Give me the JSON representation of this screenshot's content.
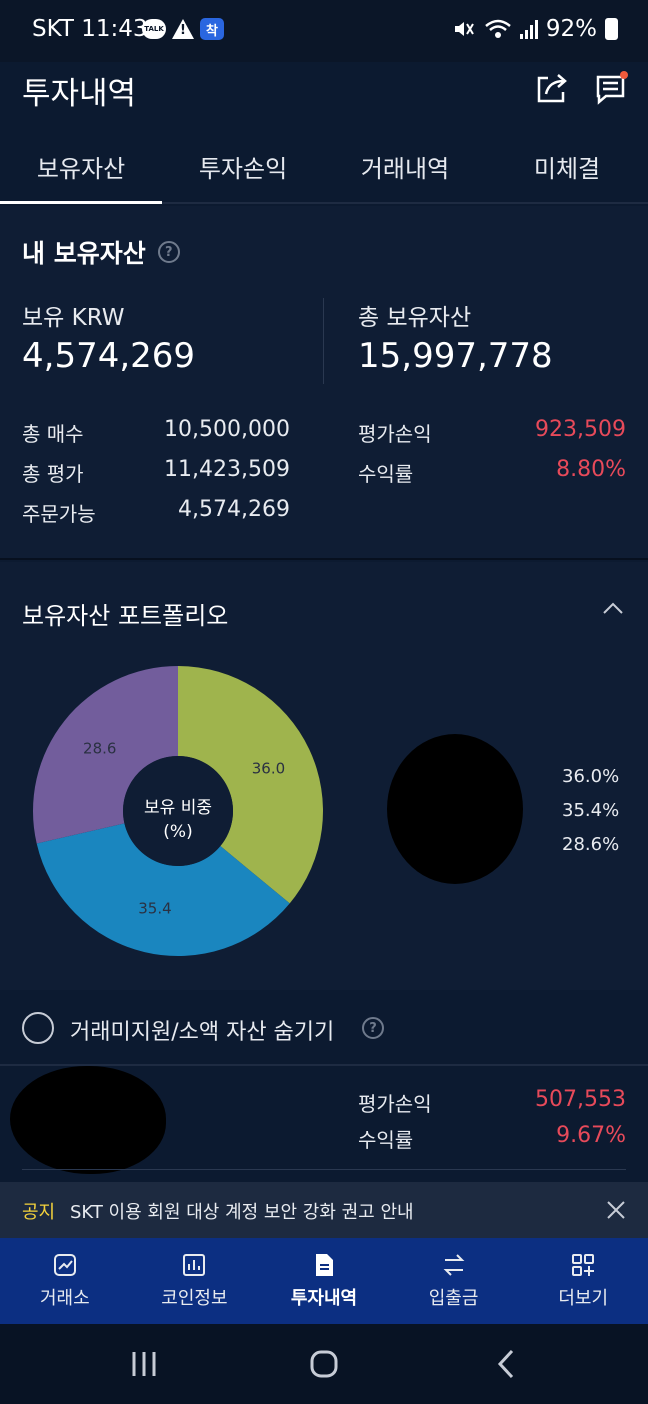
{
  "status_bar": {
    "carrier_time": "SKT 11:43",
    "talk_badge": "TALK",
    "app_badge": "착",
    "battery": "92%"
  },
  "header": {
    "title": "투자내역",
    "icons": [
      "share-icon",
      "message-icon"
    ]
  },
  "tabs": [
    {
      "label": "보유자산",
      "active": true
    },
    {
      "label": "투자손익",
      "active": false
    },
    {
      "label": "거래내역",
      "active": false
    },
    {
      "label": "미체결",
      "active": false
    }
  ],
  "holdings": {
    "title": "내 보유자산",
    "krw_label": "보유 KRW",
    "krw_value": "4,574,269",
    "total_label": "총 보유자산",
    "total_value": "15,997,778",
    "rows_left": [
      {
        "label": "총 매수",
        "value": "10,500,000"
      },
      {
        "label": "총 평가",
        "value": "11,423,509"
      },
      {
        "label": "주문가능",
        "value": "4,574,269"
      }
    ],
    "rows_right": [
      {
        "label": "평가손익",
        "value": "923,509"
      },
      {
        "label": "수익률",
        "value": "8.80%"
      }
    ]
  },
  "portfolio": {
    "title": "보유자산 포트폴리오",
    "center_label_1": "보유 비중",
    "center_label_2": "(%)",
    "legend": [
      "36.0%",
      "35.4%",
      "28.6%"
    ]
  },
  "chart_data": {
    "type": "pie",
    "title": "",
    "categories": [
      "",
      "",
      ""
    ],
    "values": [
      36.0,
      35.4,
      28.6
    ],
    "value_labels": [
      "36.0",
      "35.4",
      "28.6"
    ],
    "colors": [
      "#9fb44d",
      "#1a86bf",
      "#725d9c"
    ],
    "donut": true
  },
  "hide_small": {
    "label": "거래미지원/소액 자산 숨기기"
  },
  "asset_item": {
    "pl_label": "평가손익",
    "pl_value": "507,553",
    "rate_label": "수익률",
    "rate_value": "9.67%"
  },
  "notice": {
    "tag": "공지",
    "text": "SKT 이용 회원 대상 계정 보안 강화 권고 안내"
  },
  "bottom_nav": [
    {
      "label": "거래소",
      "icon": "chart-line-icon",
      "active": false
    },
    {
      "label": "코인정보",
      "icon": "bar-chart-icon",
      "active": false
    },
    {
      "label": "투자내역",
      "icon": "document-icon",
      "active": true
    },
    {
      "label": "입출금",
      "icon": "transfer-icon",
      "active": false
    },
    {
      "label": "더보기",
      "icon": "grid-plus-icon",
      "active": false
    }
  ],
  "colors": {
    "background": "#0c1a30",
    "panel": "#0f1d34",
    "negative_red": "#e74a5a",
    "nav_blue": "#0c2f82",
    "notice_yellow": "#f4d23c"
  }
}
